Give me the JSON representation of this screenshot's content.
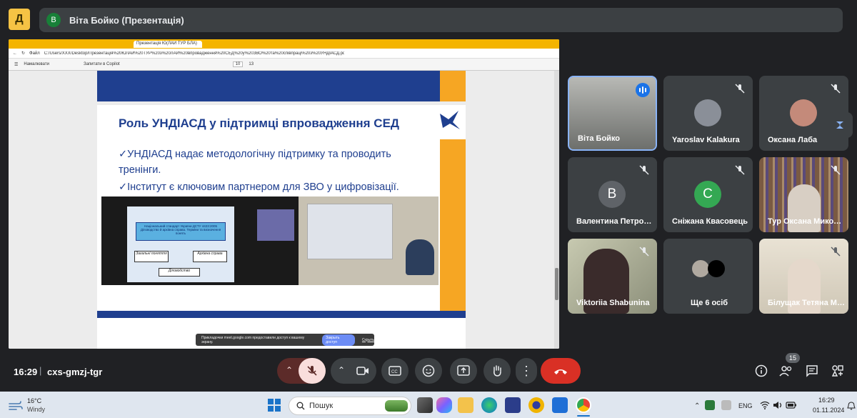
{
  "app": {
    "logo_letter": "Д"
  },
  "presenter": {
    "avatar_letter": "В",
    "title": "Віта Бойко (Презентація)"
  },
  "browser": {
    "tab_label": "Презентація Ю(ЛАЙ ТУР БЛА)",
    "addr_prefix": "Файл",
    "url": "C:/Users/XXX/Desktop/Презентація%20ЮЛАЙ%20ТУР%20з%20ЛАЙ%20впровадження%20СЕД%20у%20ЗВО%20та%20співпраці%20з%20УНДІАСД.pdf",
    "pdf_tools": [
      "Намалювати",
      "Запитати в Copilot"
    ],
    "page_current": "10",
    "page_total": "13"
  },
  "slide": {
    "title": "Роль УНДІАСД у підтримці впровадження СЕД",
    "bullets": [
      "✓УНДІАСД надає методологічну підтримку та проводить тренінги.",
      "✓Інститут є ключовим партнером для ЗВО у цифровізації."
    ],
    "photo_box_text": "Національний стандарт України ДСТУ 4423:2005 Діловодство й архівна справа. Терміни та визначення понять",
    "photo_terms": [
      "Загальні поняття",
      "Архівна справа",
      "Діловодство"
    ]
  },
  "share_notice": {
    "text": "Прикладочки meet.google.com предоставили доступ к вашему экрану.",
    "button": "Закрыть доступ",
    "hide": "Скрыть"
  },
  "participants": [
    {
      "name": "Віта Бойко",
      "speaking": true
    },
    {
      "name": "Yaroslav Kalakura",
      "muted": true
    },
    {
      "name": "Оксана Лаба",
      "muted": true
    },
    {
      "name": "Валентина Петро…",
      "avatar_letter": "В",
      "avatar_color": "#5f6368",
      "muted": true
    },
    {
      "name": "Сніжана Квасовець",
      "avatar_letter": "С",
      "avatar_color": "#34a853",
      "muted": true
    },
    {
      "name": "Тур Оксана Мико…",
      "muted": true
    },
    {
      "name": "Viktoriia Shabunina",
      "muted": true
    },
    {
      "name": "Ще 6 осіб"
    },
    {
      "name": "Білущак Тетяна М…",
      "muted": true
    }
  ],
  "controls": {
    "time": "16:29",
    "separator": "|",
    "meeting_code": "cxs-gmzj-tgr",
    "people_count": "15"
  },
  "taskbar": {
    "temp": "16°C",
    "weather": "Windy",
    "search": "Пошук",
    "lang": "ENG",
    "time": "16:29",
    "date": "01.11.2024"
  },
  "colors": {
    "meet_bg": "#202124",
    "tile_bg": "#3c4043",
    "slide_blue": "#1f3f8f",
    "slide_orange": "#f6a623",
    "end_call": "#d93025",
    "active_blue": "#1a73e8"
  }
}
